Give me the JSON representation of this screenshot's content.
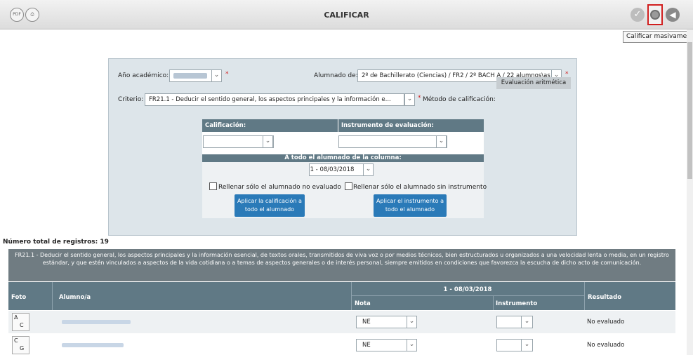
{
  "header": {
    "title": "CALIFICAR",
    "tooltip": "Calificar masivamente"
  },
  "icons": {
    "left1": "PDF",
    "left2": "print"
  },
  "filters": {
    "year_label": "Año académico:",
    "group_label": "Alumnado de:",
    "group_value": "2º de Bachillerato (Ciencias) / FR2 / 2º BACH A / 22 alumnos\\as",
    "criterion_label": "Criterio:",
    "criterion_value": "FR21.1 - Deducir el sentido general, los aspectos principales y la información e...",
    "method_label": "Método de calificación:",
    "method_value": "Evaluación aritmética",
    "required_mark": "*"
  },
  "mass": {
    "grade_header": "Calificación:",
    "instrument_header": "Instrumento de evaluación:",
    "all_students_header": "A todo el alumnado de la columna:",
    "date_value": "1 - 08/03/2018",
    "fill_unassessed": "Rellenar sólo el alumnado no evaluado",
    "fill_no_instrument": "Rellenar sólo el alumnado sin instrumento",
    "apply_grade_line1": "Aplicar la calificación a",
    "apply_grade_line2": "todo el alumnado",
    "apply_instrument_line1": "Aplicar el instrumento a",
    "apply_instrument_line2": "todo el alumnado"
  },
  "records": {
    "count_label": "Número total de registros: 19",
    "criterion_full": "FR21.1 - Deducir el sentido general, los aspectos principales y la información esencial, de textos orales, transmitidos de viva voz o por medios técnicos, bien estructurados u organizados a una velocidad lenta o media, en un registro estándar, y que estén vinculados a aspectos de la vida cotidiana o a temas de aspectos generales o de interés personal, siempre emitidos en condiciones que favorezca la escucha de dicho acto de comunicación.",
    "columns": {
      "photo": "Foto",
      "student": "Alumno/a",
      "session": "1 - 08/03/2018",
      "grade": "Nota",
      "instrument": "Instrumento",
      "result": "Resultado"
    },
    "rows": [
      {
        "photo_l1": "A",
        "photo_l2": "C",
        "grade": "NE",
        "result": "No evaluado"
      },
      {
        "photo_l1": "C",
        "photo_l2": "G",
        "grade": "NE",
        "result": "No evaluado"
      }
    ]
  }
}
